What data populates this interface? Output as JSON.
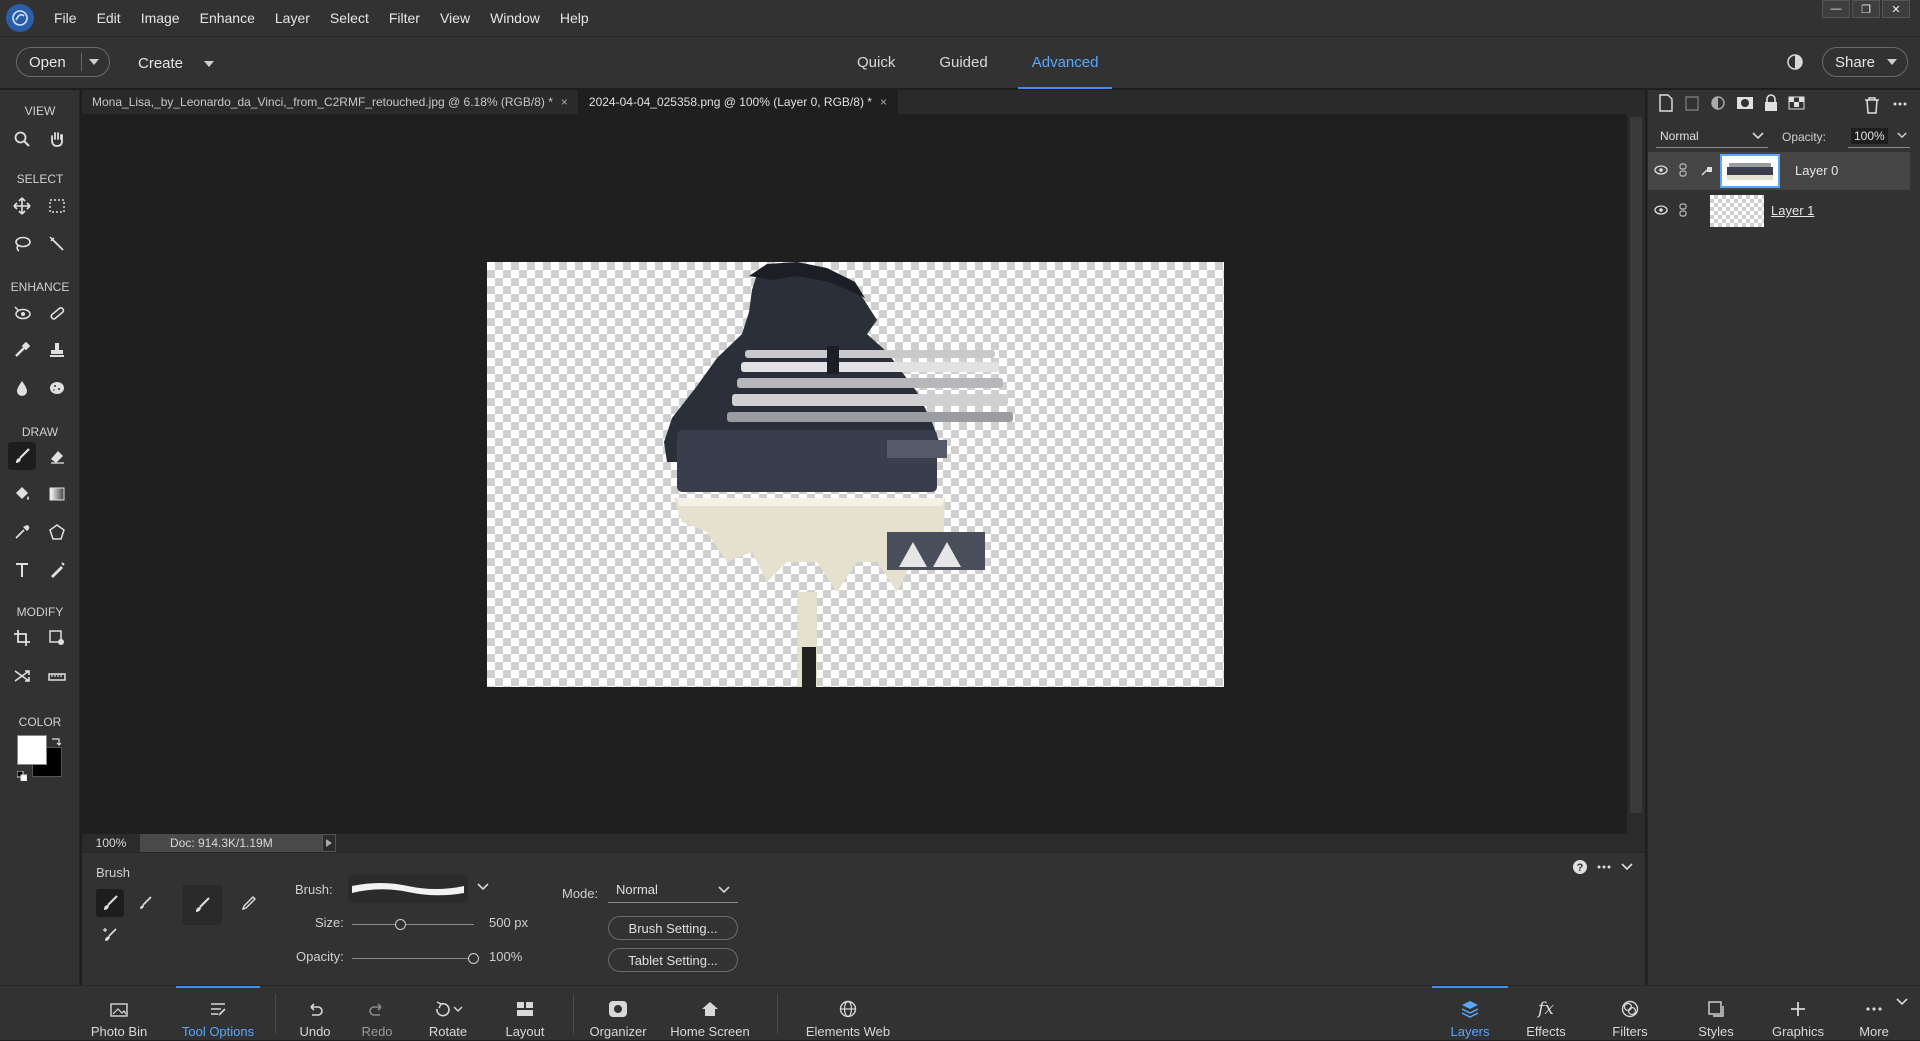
{
  "menubar": {
    "items": [
      "File",
      "Edit",
      "Image",
      "Enhance",
      "Layer",
      "Select",
      "Filter",
      "View",
      "Window",
      "Help"
    ]
  },
  "modebar": {
    "open_label": "Open",
    "create_label": "Create",
    "modes": [
      "Quick",
      "Guided",
      "Advanced"
    ],
    "active_mode": "Advanced",
    "share_label": "Share"
  },
  "toolbox": {
    "sections": [
      "VIEW",
      "SELECT",
      "ENHANCE",
      "DRAW",
      "MODIFY",
      "COLOR"
    ],
    "foreground_color": "#ffffff",
    "background_color": "#000000"
  },
  "doc_tabs": [
    {
      "title": "Mona_Lisa,_by_Leonardo_da_Vinci,_from_C2RMF_retouched.jpg @ 6.18% (RGB/8) *",
      "close": "×"
    },
    {
      "title": "2024-04-04_025358.png @ 100% (Layer 0, RGB/8) *",
      "close": "×"
    }
  ],
  "status": {
    "zoom": "100%",
    "doc": "Doc: 914.3K/1.19M"
  },
  "tool_options": {
    "tool_name": "Brush",
    "brush_label": "Brush:",
    "size_label": "Size:",
    "size_value": "500 px",
    "size_fraction": 0.4,
    "opacity_label": "Opacity:",
    "opacity_value": "100%",
    "opacity_fraction": 1.0,
    "mode_label": "Mode:",
    "mode_value": "Normal",
    "brush_settings": "Brush Setting...",
    "tablet_settings": "Tablet Setting..."
  },
  "layers_panel": {
    "blend_mode": "Normal",
    "opacity_label": "Opacity:",
    "opacity_value": "100%",
    "layers": [
      {
        "name": "Layer 0",
        "selected": true
      },
      {
        "name": "Layer 1",
        "selected": false
      }
    ]
  },
  "taskbar": {
    "left": [
      "Photo Bin",
      "Tool Options",
      "Undo",
      "Redo",
      "Rotate",
      "Layout",
      "Organizer",
      "Home Screen",
      "Elements Web"
    ],
    "right": [
      "Layers",
      "Effects",
      "Filters",
      "Styles",
      "Graphics",
      "More"
    ],
    "active_left": "Tool Options",
    "active_right": "Layers"
  },
  "colors": {
    "accent": "#3d8ef0",
    "panel": "#323232",
    "canvas_bg": "#1f1f1f"
  }
}
